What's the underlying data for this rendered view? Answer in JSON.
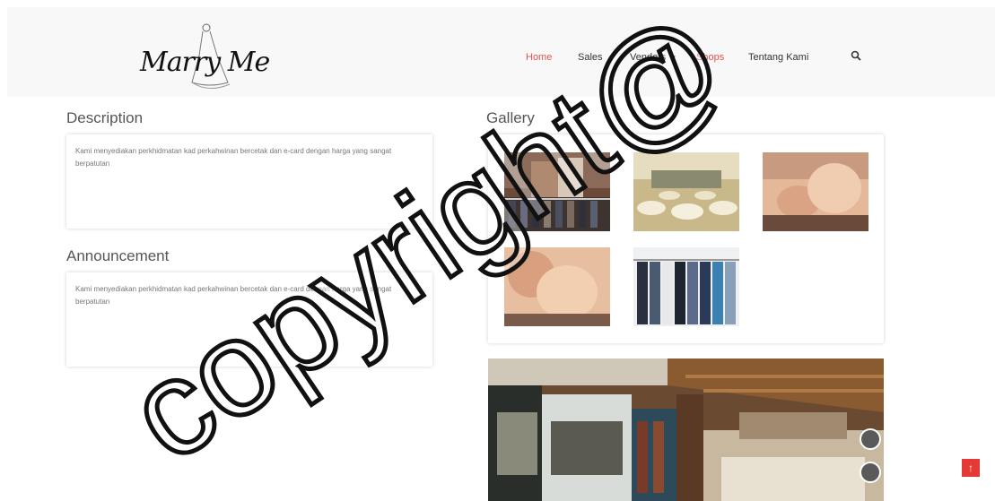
{
  "brand": {
    "logo_text": "Marry Me"
  },
  "nav": {
    "home": "Home",
    "sales": "Sales",
    "vendors": "Vendors",
    "shops": "Shops",
    "about": "Tentang Kami"
  },
  "description": {
    "title": "Description",
    "text": "Kami menyediakan perkhidmatan kad perkahwinan bercetak dan e-card dengan harga yang sangat berpatutan"
  },
  "announcement": {
    "title": "Announcement",
    "text": "Kami menyediakan perkhidmatan kad perkahwinan bercetak dan e-card dengan harga yang sangat berpatutan"
  },
  "gallery": {
    "title": "Gallery"
  },
  "watermark": "copyright@",
  "colors": {
    "accent": "#e05252",
    "header_bg": "#f8f8f8",
    "to_top": "#e53935"
  },
  "icons": {
    "search": "search-icon",
    "dropdown": "caret-down-icon",
    "to_top": "arrow-up-icon",
    "pano_fullscreen": "fullscreen-icon",
    "pano_vr": "vr-icon"
  }
}
